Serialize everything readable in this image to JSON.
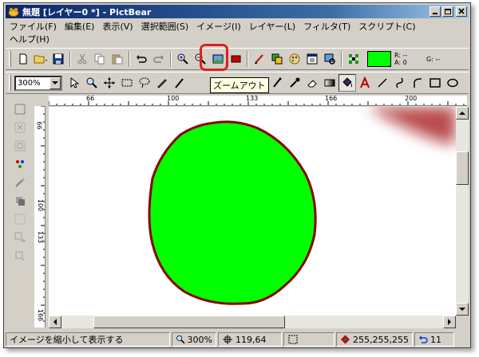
{
  "window": {
    "title": "無題 [レイヤー0 *] - PictBear"
  },
  "menu": {
    "row1": [
      "ファイル(F)",
      "編集(E)",
      "表示(V)",
      "選択範囲(S)",
      "イメージ(I)",
      "レイヤー(L)",
      "フィルタ(T)",
      "スクリプト(C)"
    ],
    "row2": [
      "ヘルプ(H)"
    ]
  },
  "toolbar": {
    "color_r": "R: --",
    "color_a": "A: 0",
    "color_g": "G: --",
    "zoom_select": "300%"
  },
  "tooltip": "ズームアウト",
  "ruler": {
    "top": [
      "66",
      "100",
      "133",
      "166",
      "200"
    ],
    "left": [
      "66",
      "100",
      "133",
      "166"
    ]
  },
  "status": {
    "message": "イメージを縮小して表示する",
    "zoom": "300%",
    "coords": "119,64",
    "color": "255,255,255",
    "undo": "11"
  },
  "colors": {
    "accent_red": "#e0201a",
    "fill_green": "#00ff00",
    "outline": "#8b0000"
  }
}
